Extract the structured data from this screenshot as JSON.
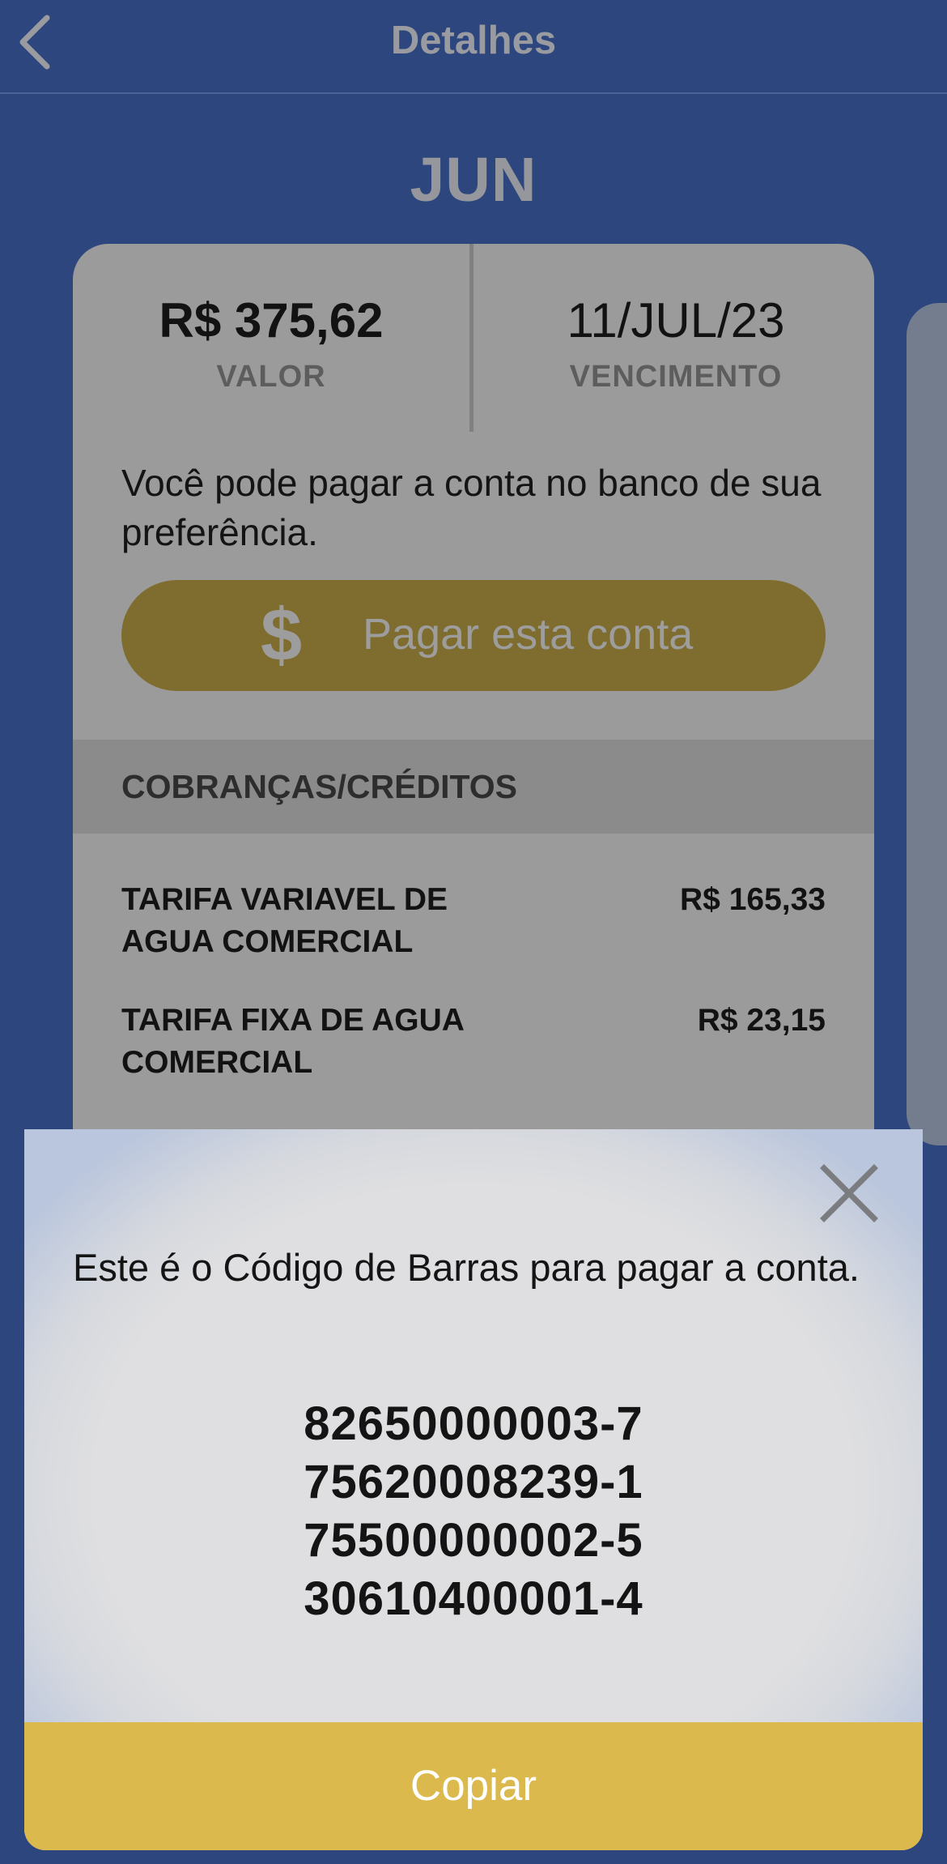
{
  "header": {
    "title": "Detalhes"
  },
  "month": "JUN",
  "bill": {
    "amount_value": "R$ 375,62",
    "amount_label": "VALOR",
    "due_value": "11/JUL/23",
    "due_label": "VENCIMENTO",
    "info_text": "Você pode pagar a conta no banco de sua preferência.",
    "pay_button": {
      "icon": "dollar-icon",
      "label": "Pagar esta conta"
    },
    "section_title": "COBRANÇAS/CRÉDITOS",
    "charges": [
      {
        "label": "TARIFA VARIAVEL DE AGUA COMERCIAL",
        "value": "R$ 165,33"
      },
      {
        "label": "TARIFA FIXA DE AGUA COMERCIAL",
        "value": "R$ 23,15"
      }
    ]
  },
  "barcode_sheet": {
    "text": "Este é o Código de Barras para pagar a conta.",
    "codes": [
      "82650000003-7",
      "75620008239-1",
      "75500000002-5",
      "30610400001-4"
    ],
    "copy_label": "Copiar",
    "close_icon": "close-icon"
  },
  "colors": {
    "background": "#2d477e",
    "accent": "#dbb94c",
    "card_dimmed": "#9b9b9b"
  }
}
